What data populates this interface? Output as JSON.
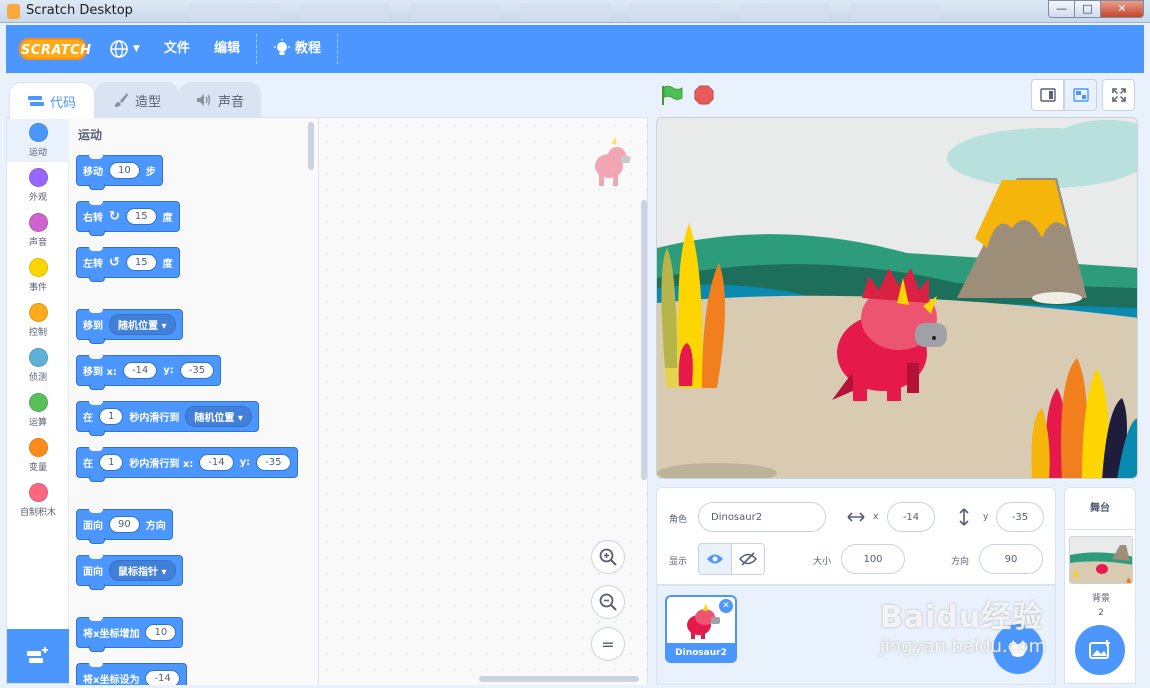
{
  "window": {
    "title": "Scratch Desktop",
    "min": "—",
    "max": "□",
    "close": "✕"
  },
  "menu": {
    "logo": "SCRATCH",
    "file": "文件",
    "edit": "编辑",
    "tutorials": "教程"
  },
  "tabs": {
    "code": "代码",
    "costumes": "造型",
    "sounds": "声音"
  },
  "categories": [
    {
      "label": "运动",
      "color": "#4c97ff"
    },
    {
      "label": "外观",
      "color": "#9966ff"
    },
    {
      "label": "声音",
      "color": "#cf63cf"
    },
    {
      "label": "事件",
      "color": "#ffd500"
    },
    {
      "label": "控制",
      "color": "#ffab19"
    },
    {
      "label": "侦测",
      "color": "#5cb1d6"
    },
    {
      "label": "运算",
      "color": "#59c059"
    },
    {
      "label": "变量",
      "color": "#ff8c1a"
    },
    {
      "label": "自制积木",
      "color": "#ff6680"
    }
  ],
  "palette": {
    "heading": "运动",
    "move": {
      "a": "移动",
      "v": "10",
      "b": "步"
    },
    "turn_right": {
      "a": "右转",
      "v": "15",
      "b": "度"
    },
    "turn_left": {
      "a": "左转",
      "v": "15",
      "b": "度"
    },
    "goto": {
      "a": "移到",
      "dd": "随机位置"
    },
    "goto_xy": {
      "a": "移到 x:",
      "x": "-14",
      "yl": "y:",
      "y": "-35"
    },
    "glide": {
      "a": "在",
      "v": "1",
      "b": "秒内滑行到",
      "dd": "随机位置"
    },
    "glide_xy": {
      "a": "在",
      "v": "1",
      "b": "秒内滑行到 x:",
      "x": "-14",
      "yl": "y:",
      "y": "-35"
    },
    "point_dir": {
      "a": "面向",
      "v": "90",
      "b": "方向"
    },
    "point_towards": {
      "a": "面向",
      "dd": "鼠标指针"
    },
    "change_x": {
      "a": "将x坐标增加",
      "v": "10"
    },
    "set_x": {
      "a": "将x坐标设为",
      "v": "-14"
    }
  },
  "zoom": {
    "in": "+",
    "out": "−",
    "reset": "="
  },
  "sprite_info": {
    "sprite_label": "角色",
    "sprite_name": "Dinosaur2",
    "x_label": "x",
    "x": "-14",
    "y_label": "y",
    "y": "-35",
    "show_label": "显示",
    "size_label": "大小",
    "size": "100",
    "direction_label": "方向",
    "direction": "90"
  },
  "sprites": [
    {
      "name": "Dinosaur2"
    }
  ],
  "stage_panel": {
    "title": "舞台",
    "backdrops_label": "背景",
    "backdrops_count": "2"
  },
  "watermark": {
    "line1": "Baidu经验",
    "line2": "jingyan.baidu.com"
  }
}
